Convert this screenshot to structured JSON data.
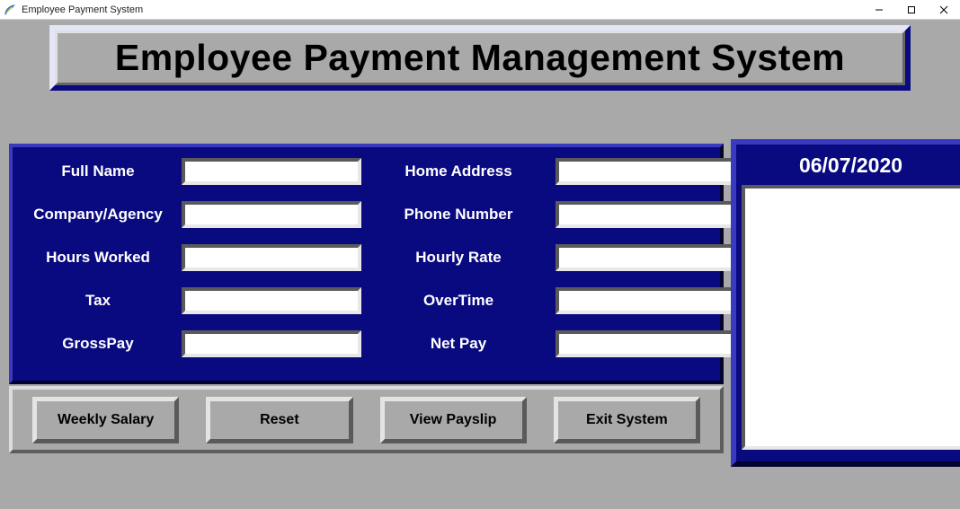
{
  "window": {
    "title": "Employee Payment System"
  },
  "banner": {
    "text": "Employee Payment Management System"
  },
  "form": {
    "left": [
      {
        "label": "Full Name",
        "value": ""
      },
      {
        "label": "Company/Agency",
        "value": ""
      },
      {
        "label": "Hours Worked",
        "value": ""
      },
      {
        "label": "Tax",
        "value": ""
      },
      {
        "label": "GrossPay",
        "value": ""
      }
    ],
    "right": [
      {
        "label": "Home Address",
        "value": ""
      },
      {
        "label": "Phone Number",
        "value": ""
      },
      {
        "label": "Hourly Rate",
        "value": ""
      },
      {
        "label": "OverTime",
        "value": ""
      },
      {
        "label": "Net Pay",
        "value": ""
      }
    ]
  },
  "buttons": {
    "weekly_salary": "Weekly Salary",
    "reset": "Reset",
    "view_payslip": "View Payslip",
    "exit_system": "Exit System"
  },
  "payslip": {
    "date": "06/07/2020",
    "content": ""
  }
}
